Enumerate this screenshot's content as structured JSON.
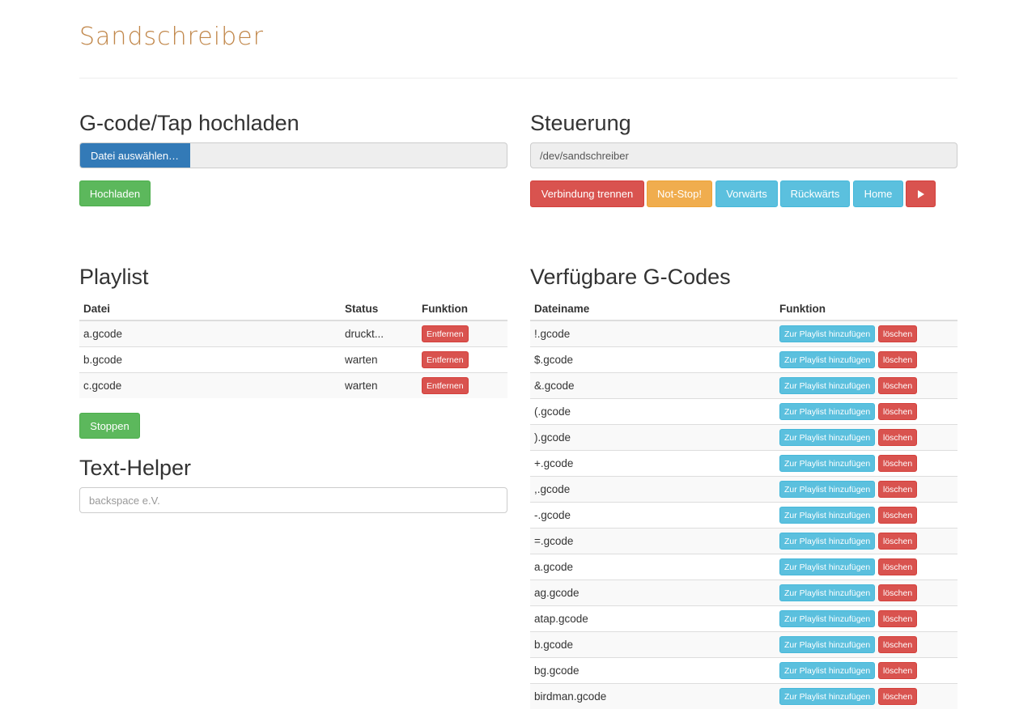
{
  "brand": "Sandschreiber",
  "upload": {
    "title": "G-code/Tap hochladen",
    "file_button": "Datei auswählen…",
    "submit": "Hochladen"
  },
  "control": {
    "title": "Steuerung",
    "port": "/dev/sandschreiber",
    "buttons": {
      "disconnect": "Verbindung trennen",
      "emergency": "Not-Stop!",
      "forward": "Vorwärts",
      "backward": "Rückwärts",
      "home": "Home"
    }
  },
  "playlist": {
    "title": "Playlist",
    "headers": {
      "file": "Datei",
      "status": "Status",
      "function": "Funktion"
    },
    "remove_label": "Entfernen",
    "rows": [
      {
        "file": "a.gcode",
        "status": "druckt..."
      },
      {
        "file": "b.gcode",
        "status": "warten"
      },
      {
        "file": "c.gcode",
        "status": "warten"
      }
    ],
    "stop": "Stoppen"
  },
  "text_helper": {
    "title": "Text-Helper",
    "placeholder": "backspace e.V."
  },
  "gcodes": {
    "title": "Verfügbare G-Codes",
    "headers": {
      "name": "Dateiname",
      "function": "Funktion"
    },
    "add_label": "Zur Playlist hinzufügen",
    "delete_label": "löschen",
    "rows": [
      "!.gcode",
      "$.gcode",
      "&.gcode",
      "(.gcode",
      ").gcode",
      "+.gcode",
      ",.gcode",
      "-.gcode",
      "=.gcode",
      "a.gcode",
      "ag.gcode",
      "atap.gcode",
      "b.gcode",
      "bg.gcode",
      "birdman.gcode"
    ]
  },
  "colors": {
    "brand": "#c1874a",
    "primary": "#337ab7",
    "success": "#5cb85c",
    "danger": "#d9534f",
    "warning": "#f0ad4e",
    "info": "#5bc0de"
  }
}
